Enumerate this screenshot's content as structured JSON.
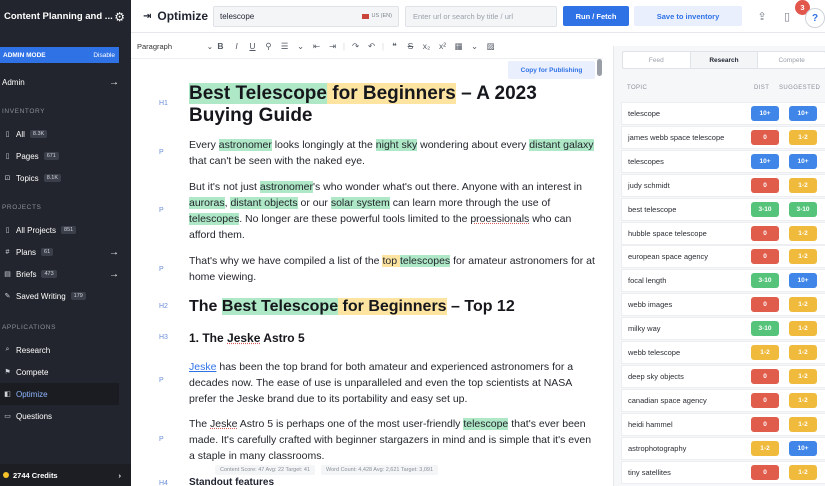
{
  "sidebar": {
    "app_title": "Content Planning and ...",
    "admin_mode": "ADMIN MODE",
    "admin_disable": "Disable",
    "admin_link": "Admin",
    "inventory_heading": "INVENTORY",
    "inventory": [
      {
        "label": "All",
        "badge": "8.3K"
      },
      {
        "label": "Pages",
        "badge": "671"
      },
      {
        "label": "Topics",
        "badge": "8.1K"
      }
    ],
    "projects_heading": "PROJECTS",
    "projects": [
      {
        "label": "All Projects",
        "badge": "851"
      },
      {
        "label": "Plans",
        "badge": "61"
      },
      {
        "label": "Briefs",
        "badge": "473"
      },
      {
        "label": "Saved Writing",
        "badge": "179"
      }
    ],
    "applications_heading": "APPLICATIONS",
    "applications": [
      {
        "label": "Research"
      },
      {
        "label": "Compete"
      },
      {
        "label": "Optimize"
      },
      {
        "label": "Questions"
      }
    ],
    "credits": "2744 Credits"
  },
  "topbar": {
    "title": "Optimize",
    "keyword": "telescope",
    "location": "US (EN)",
    "url_placeholder": "Enter url or search by title / url",
    "run_label": "Run / Fetch",
    "save_label": "Save to inventory",
    "notifications": "3",
    "help": "?"
  },
  "toolbar": {
    "paragraph": "Paragraph"
  },
  "editor": {
    "copy_label": "Copy for Publishing",
    "tags": {
      "h1": "H1",
      "p": "P",
      "h2": "H2",
      "h3": "H3",
      "h4": "H4"
    },
    "h1_a": "Best Telescope",
    "h1_b": " ",
    "h1_c": "for Beginners",
    "h1_d": " – A 2023 Buying Guide",
    "p1": [
      "Every ",
      "astronomer",
      " looks longingly at the ",
      "night sky",
      " wondering about every ",
      "distant galaxy",
      " that can't be seen with the naked eye."
    ],
    "p2": [
      "But it's not just ",
      "astronomer",
      "'s who wonder what's out there. Anyone with an interest in ",
      "auroras",
      ", ",
      "distant objects",
      " or our ",
      "solar system",
      " can learn more through the use of ",
      "telescopes",
      ". No longer are these powerful tools limited to the ",
      "proessionals",
      " who can afford them."
    ],
    "p3": [
      "That's why we have compiled a list of the ",
      "top",
      " ",
      "telescopes",
      " for amateur astronomers for at home viewing."
    ],
    "h2_a": "The ",
    "h2_b": "Best Telescope",
    "h2_c": " ",
    "h2_d": "for Beginners",
    "h2_e": " – Top 12",
    "h3_a": "1. The ",
    "h3_b": "Jeske",
    "h3_c": " Astro 5",
    "p4": [
      "Jeske",
      " has been the top brand for both amateur and experienced astronomers for a decades now. The ease of use is unparalleled and even the top scientists at NASA prefer the Jeske brand due to its portability and easy set up."
    ],
    "p5": [
      "The ",
      "Jeske",
      " Astro 5 is perhaps one of the most user-friendly ",
      "telescope",
      " that's ever been made. It's carefully crafted with beginner stargazers in mind and is simple that it's even a staple in many classrooms."
    ],
    "h4": "Standout features",
    "metrics": {
      "content_score": "Content Score: 47  Avg: 22  Target: 41",
      "word_count": "Word Count: 4,428  Avg: 2,621  Target: 3,091"
    }
  },
  "panel": {
    "tabs": [
      "Feed",
      "Research",
      "Compete"
    ],
    "active_tab": "Research",
    "headers": {
      "topic": "TOPIC",
      "dist": "DIST",
      "suggested": "SUGGESTED"
    },
    "colors": {
      "blue": "#3f86e8",
      "red": "#e05c4b",
      "yellow": "#f0bb3d",
      "green": "#55c47a"
    },
    "rows": [
      {
        "topic": "telescope",
        "dist": "10+",
        "dist_color": "blue",
        "sugg": "10+",
        "sugg_color": "blue"
      },
      {
        "topic": "james webb space telescope",
        "dist": "0",
        "dist_color": "red",
        "sugg": "1-2",
        "sugg_color": "yellow"
      },
      {
        "topic": "telescopes",
        "dist": "10+",
        "dist_color": "blue",
        "sugg": "10+",
        "sugg_color": "blue"
      },
      {
        "topic": "judy schmidt",
        "dist": "0",
        "dist_color": "red",
        "sugg": "1-2",
        "sugg_color": "yellow"
      },
      {
        "topic": "best telescope",
        "dist": "3-10",
        "dist_color": "green",
        "sugg": "3-10",
        "sugg_color": "green"
      },
      {
        "topic": "hubble space telescope",
        "dist": "0",
        "dist_color": "red",
        "sugg": "1-2",
        "sugg_color": "yellow"
      },
      {
        "topic": "european space agency",
        "dist": "0",
        "dist_color": "red",
        "sugg": "1-2",
        "sugg_color": "yellow"
      },
      {
        "topic": "focal length",
        "dist": "3-10",
        "dist_color": "green",
        "sugg": "10+",
        "sugg_color": "blue"
      },
      {
        "topic": "webb images",
        "dist": "0",
        "dist_color": "red",
        "sugg": "1-2",
        "sugg_color": "yellow"
      },
      {
        "topic": "milky way",
        "dist": "3-10",
        "dist_color": "green",
        "sugg": "1-2",
        "sugg_color": "yellow"
      },
      {
        "topic": "webb telescope",
        "dist": "1-2",
        "dist_color": "yellow",
        "sugg": "1-2",
        "sugg_color": "yellow"
      },
      {
        "topic": "deep sky objects",
        "dist": "0",
        "dist_color": "red",
        "sugg": "1-2",
        "sugg_color": "yellow"
      },
      {
        "topic": "canadian space agency",
        "dist": "0",
        "dist_color": "red",
        "sugg": "1-2",
        "sugg_color": "yellow"
      },
      {
        "topic": "heidi hammel",
        "dist": "0",
        "dist_color": "red",
        "sugg": "1-2",
        "sugg_color": "yellow"
      },
      {
        "topic": "astrophotography",
        "dist": "1-2",
        "dist_color": "yellow",
        "sugg": "10+",
        "sugg_color": "blue"
      },
      {
        "topic": "tiny satellites",
        "dist": "0",
        "dist_color": "red",
        "sugg": "1-2",
        "sugg_color": "yellow"
      }
    ]
  }
}
